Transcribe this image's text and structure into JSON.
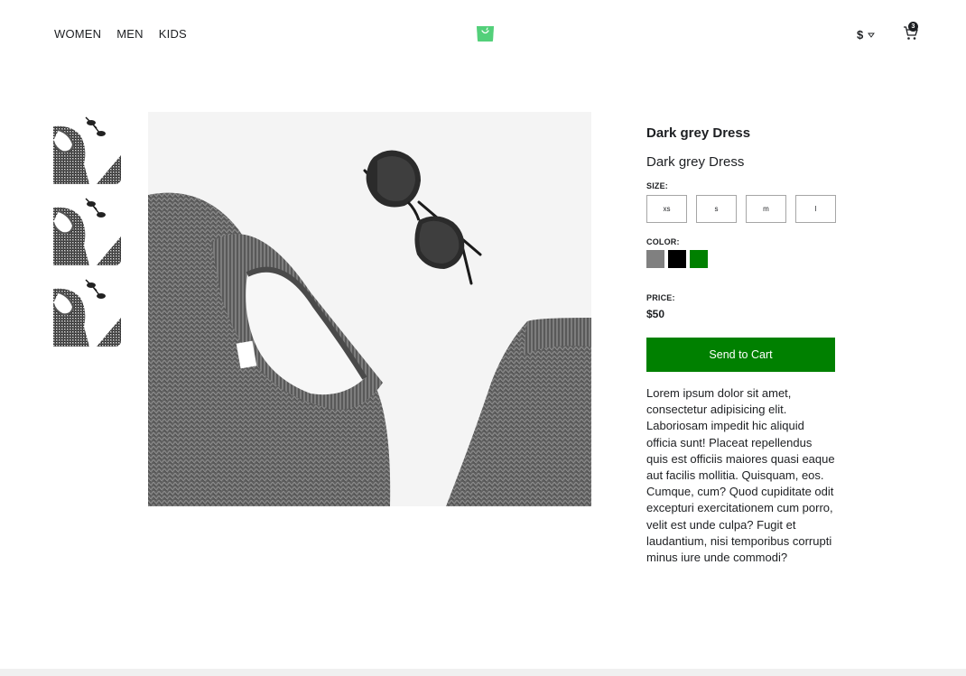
{
  "nav": {
    "items": [
      {
        "label": "WOMEN"
      },
      {
        "label": "MEN"
      },
      {
        "label": "KIDS"
      }
    ]
  },
  "header": {
    "logo_icon": "shopping-bag-icon",
    "logo_color": "#5ECE7B",
    "currency_symbol": "$",
    "currency_dropdown_icon": "chevron-down-icon",
    "cart_icon": "cart-icon",
    "cart_count": "3"
  },
  "gallery": {
    "thumbnail_count": 3
  },
  "product": {
    "brand": "Dark grey Dress",
    "name": "Dark grey Dress",
    "size_label": "SIZE:",
    "sizes": [
      "xs",
      "s",
      "m",
      "l"
    ],
    "color_label": "COLOR:",
    "colors": [
      "#808080",
      "#000000",
      "#008000"
    ],
    "price_label": "PRICE:",
    "price": "$50",
    "cta_label": "Send to Cart",
    "cta_color": "#008000",
    "description": "Lorem ipsum dolor sit amet, consectetur adipisicing elit. Laboriosam impedit hic aliquid officia sunt! Placeat repellendus quis est officiis maiores quasi eaque aut facilis mollitia. Quisquam, eos. Cumque, cum? Quod cupiditate odit excepturi exercitationem cum porro, velit est unde culpa? Fugit et laudantium, nisi temporibus corrupti minus iure unde commodi?"
  }
}
